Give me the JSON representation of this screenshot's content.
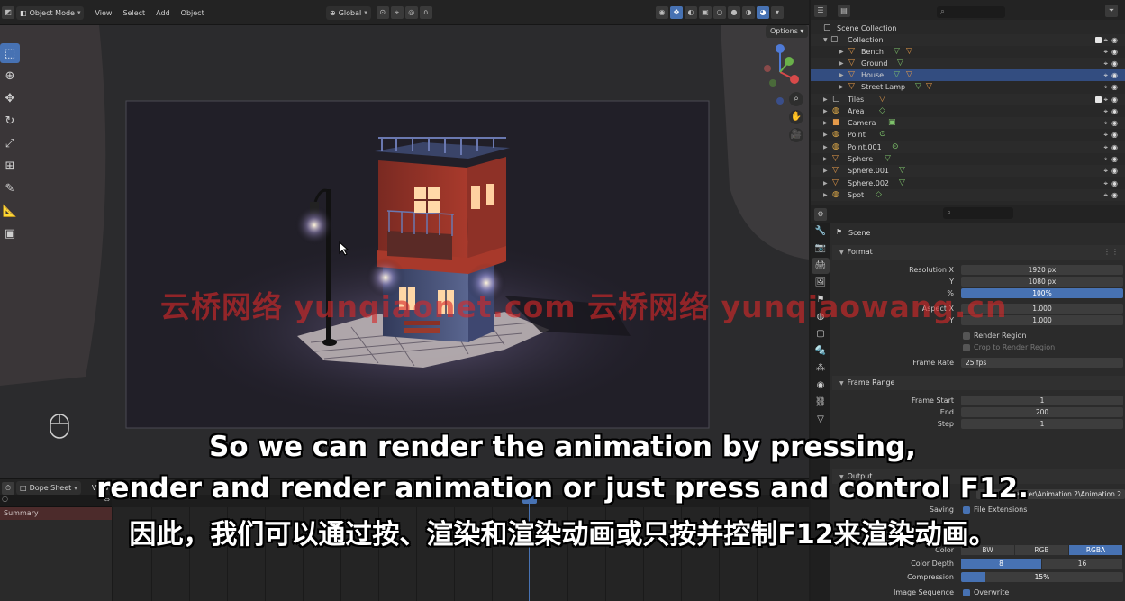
{
  "viewport_header": {
    "mode": "Object Mode",
    "menus": [
      "View",
      "Select",
      "Add",
      "Object"
    ],
    "orientation": "Global",
    "options": "Options"
  },
  "dopesheet": {
    "editor": "Dope Sheet",
    "view_menu": "View",
    "summary": "Summary"
  },
  "outliner": {
    "root": "Scene Collection",
    "items": [
      {
        "label": "Collection",
        "kind": "collection"
      },
      {
        "label": "Bench",
        "kind": "mesh"
      },
      {
        "label": "Ground",
        "kind": "mesh"
      },
      {
        "label": "House",
        "kind": "mesh"
      },
      {
        "label": "Street Lamp",
        "kind": "mesh"
      },
      {
        "label": "Tiles",
        "kind": "mesh"
      },
      {
        "label": "Area",
        "kind": "light"
      },
      {
        "label": "Camera",
        "kind": "camera"
      },
      {
        "label": "Point",
        "kind": "light"
      },
      {
        "label": "Point.001",
        "kind": "light"
      },
      {
        "label": "Sphere",
        "kind": "mesh"
      },
      {
        "label": "Sphere.001",
        "kind": "mesh"
      },
      {
        "label": "Sphere.002",
        "kind": "mesh"
      },
      {
        "label": "Spot",
        "kind": "light"
      }
    ]
  },
  "properties": {
    "breadcrumb": "Scene",
    "format": {
      "title": "Format",
      "resolution_x_label": "Resolution X",
      "resolution_x": "1920 px",
      "y_label": "Y",
      "resolution_y": "1080 px",
      "percent_label": "%",
      "percent": "100%",
      "aspect_x_label": "Aspect X",
      "aspect_x": "1.000",
      "aspect_y": "1.000",
      "render_region": "Render Region",
      "crop_region": "Crop to Render Region",
      "frame_rate_label": "Frame Rate",
      "frame_rate": "25 fps"
    },
    "frame_range": {
      "title": "Frame Range",
      "start_label": "Frame Start",
      "start": "1",
      "end_label": "End",
      "end": "200",
      "step_label": "Step",
      "step": "1"
    },
    "output": {
      "title": "Output",
      "path": "Render\\Animation 2\\Animation 2",
      "saving_label": "Saving",
      "file_extensions": "File Extensions",
      "color_label": "Color",
      "color_options": [
        "BW",
        "RGB",
        "RGBA"
      ],
      "color_selected": "RGBA",
      "depth_label": "Color Depth",
      "depth_options": [
        "8",
        "16"
      ],
      "depth_selected": "8",
      "compression_label": "Compression",
      "compression": "15%",
      "compression_level": 0.15,
      "sequence_label": "Image Sequence",
      "overwrite": "Overwrite"
    }
  },
  "watermark": "云桥网络 yunqiaonet.com 云桥网络 yunqiaowang.cn",
  "subtitles": {
    "line1": "So we can render the animation by pressing,",
    "line2": "render and render animation or just press and control F12.",
    "line3": "因此，我们可以通过按、渲染和渲染动画或只按并控制F12来渲染动画。"
  },
  "colors": {
    "accent": "#4772b3",
    "selected_row": "#334d80",
    "object_icon": "#e59a4a",
    "data_icon": "#7ec26b",
    "watermark": "#d62828"
  }
}
